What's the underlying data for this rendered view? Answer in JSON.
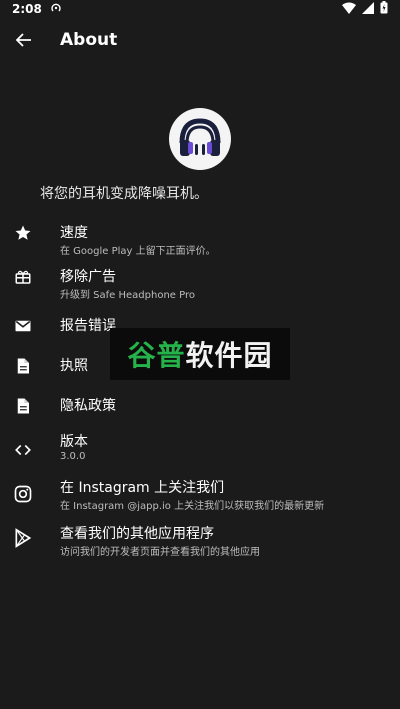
{
  "status_bar": {
    "time": "2:08"
  },
  "app_bar": {
    "title": "About"
  },
  "tagline": "将您的耳机变成降噪耳机。",
  "items": [
    {
      "label": "速度",
      "subtitle": "在 Google Play 上留下正面评价。",
      "icon": "star-icon"
    },
    {
      "label": "移除广告",
      "subtitle": "升级到 Safe Headphone Pro",
      "icon": "gift-icon"
    },
    {
      "label": "报告错误",
      "subtitle": "",
      "icon": "mail-icon"
    },
    {
      "label": "执照",
      "subtitle": "",
      "icon": "document-icon"
    },
    {
      "label": "隐私政策",
      "subtitle": "",
      "icon": "document-icon"
    },
    {
      "label": "版本",
      "subtitle": "3.0.0",
      "icon": "code-icon"
    },
    {
      "label": "在 Instagram 上关注我们",
      "subtitle": "在 Instagram @japp.io 上关注我们以获取我们的最新更新",
      "icon": "instagram-icon"
    },
    {
      "label": "查看我们的其他应用程序",
      "subtitle": "访问我们的开发者页面并查看我们的其他应用",
      "icon": "play-store-icon"
    }
  ],
  "watermark": {
    "part1": "谷普",
    "part2": "软件园"
  },
  "colors": {
    "background": "#1b1b1b",
    "accent": "#6a4bd4",
    "watermark_green": "#26b24a"
  }
}
